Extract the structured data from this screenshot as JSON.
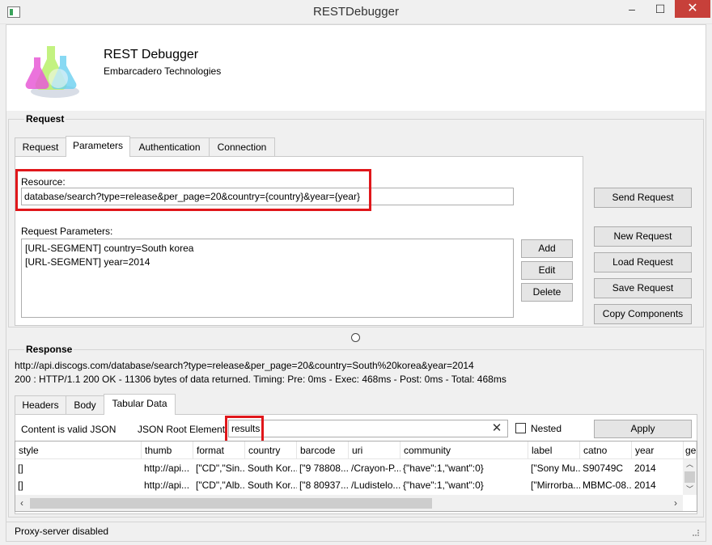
{
  "window": {
    "title": "RESTDebugger",
    "minimize": "–",
    "maximize": "☐",
    "close": "✕"
  },
  "header": {
    "app_name": "REST Debugger",
    "company": "Embarcadero Technologies"
  },
  "request": {
    "group_title": "Request",
    "tabs": [
      "Request",
      "Parameters",
      "Authentication",
      "Connection"
    ],
    "active_tab": "Parameters",
    "resource_label": "Resource:",
    "resource_value": "database/search?type=release&per_page=20&country={country}&year={year}",
    "params_label": "Request Parameters:",
    "params": [
      "[URL-SEGMENT] country=South korea",
      "[URL-SEGMENT] year=2014"
    ],
    "param_buttons": {
      "add": "Add",
      "edit": "Edit",
      "delete": "Delete"
    },
    "actions": {
      "send": "Send Request",
      "new": "New Request",
      "load": "Load Request",
      "save": "Save Request",
      "copy": "Copy Components"
    }
  },
  "response": {
    "group_title": "Response",
    "url": "http://api.discogs.com/database/search?type=release&per_page=20&country=South%20korea&year=2014",
    "status": "200 : HTTP/1.1 200 OK - 11306 bytes of data returned. Timing: Pre: 0ms - Exec: 468ms - Post: 0ms - Total: 468ms",
    "tabs": [
      "Headers",
      "Body",
      "Tabular Data"
    ],
    "active_tab": "Tabular Data",
    "valid_json": "Content is valid JSON",
    "root_label": "JSON Root Element:",
    "root_value": "results",
    "clear_icon": "✕",
    "nested_label": "Nested",
    "nested_checked": false,
    "apply": "Apply",
    "columns": [
      "style",
      "thumb",
      "format",
      "country",
      "barcode",
      "uri",
      "community",
      "label",
      "catno",
      "year",
      "ge"
    ],
    "rows": [
      [
        "[]",
        "http://api...",
        "[\"CD\",\"Sin...",
        "South Kor...",
        "[\"9 78808...",
        "/Crayon-P...",
        "{\"have\":1,\"want\":0}",
        "[\"Sony Mu...",
        "S90749C",
        "2014",
        ""
      ],
      [
        "[]",
        "http://api...",
        "[\"CD\",\"Alb...",
        "South Kor...",
        "[\"8 80937...",
        "/Ludistelo...",
        "{\"have\":1,\"want\":0}",
        "[\"Mirrorba...",
        "MBMC-08...",
        "2014",
        ""
      ]
    ]
  },
  "status_bar": {
    "text": "Proxy-server disabled"
  },
  "colors": {
    "highlight_border": "#e0171b",
    "close_button": "#c7403a"
  }
}
